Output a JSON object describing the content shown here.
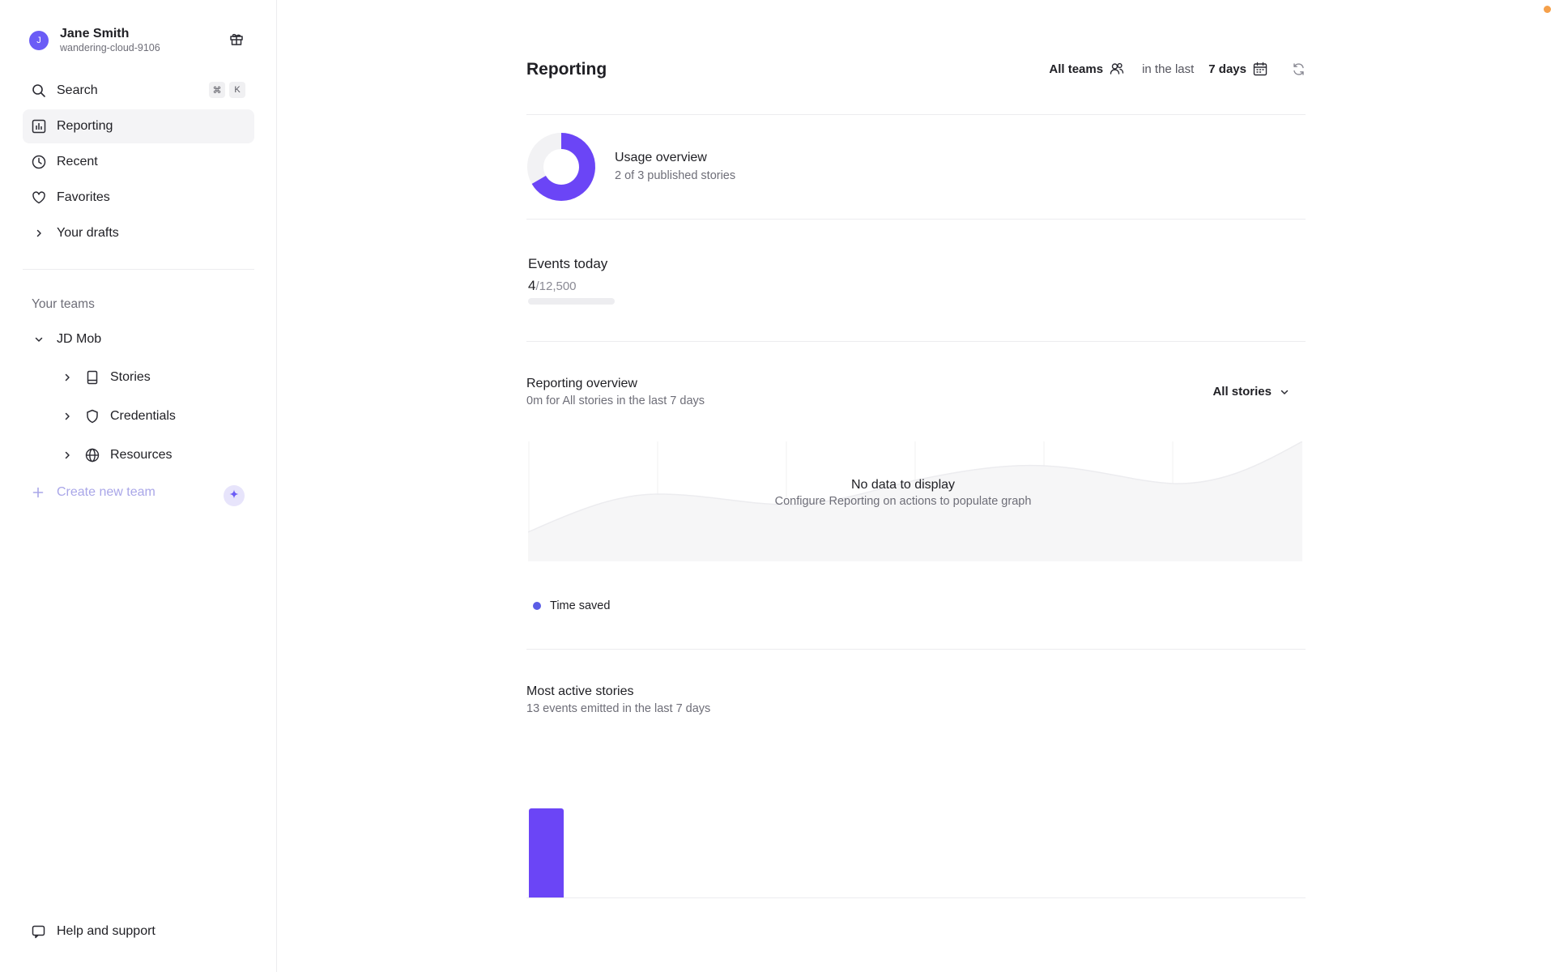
{
  "user": {
    "initial": "J",
    "name": "Jane Smith",
    "handle": "wandering-cloud-9106"
  },
  "sidebar": {
    "nav": [
      {
        "label": "Search",
        "icon": "search-icon",
        "shortcut": [
          "⌘",
          "K"
        ]
      },
      {
        "label": "Reporting",
        "icon": "bar-chart-icon",
        "active": true
      },
      {
        "label": "Recent",
        "icon": "clock-icon"
      },
      {
        "label": "Favorites",
        "icon": "heart-icon"
      },
      {
        "label": "Your drafts",
        "icon": "chevron-right-icon"
      }
    ],
    "teams_label": "Your teams",
    "team": {
      "name": "JD Mob",
      "children": [
        {
          "label": "Stories",
          "icon": "book-icon"
        },
        {
          "label": "Credentials",
          "icon": "shield-icon"
        },
        {
          "label": "Resources",
          "icon": "globe-icon"
        }
      ]
    },
    "create_team": "Create new team",
    "help": "Help and support"
  },
  "header": {
    "title": "Reporting",
    "teams": "All teams",
    "range_prefix": "in the last",
    "range": "7 days"
  },
  "usage": {
    "title": "Usage overview",
    "subtitle": "2 of 3 published stories",
    "published": 2,
    "total": 3
  },
  "events": {
    "title": "Events today",
    "count": "4",
    "max": "/12,500",
    "fraction": 0.00032
  },
  "reporting_overview": {
    "title": "Reporting overview",
    "subtitle": "0m for All stories in the last 7 days",
    "filter": "All stories",
    "empty_title": "No data to display",
    "empty_subtitle": "Configure Reporting on actions to populate graph",
    "legend": "Time saved"
  },
  "most_active": {
    "title": "Most active stories",
    "subtitle": "13 events emitted in the last 7 days"
  },
  "colors": {
    "accent": "#6b45f6",
    "legend_dot": "#5b5de6",
    "notification": "#f5a04a"
  }
}
